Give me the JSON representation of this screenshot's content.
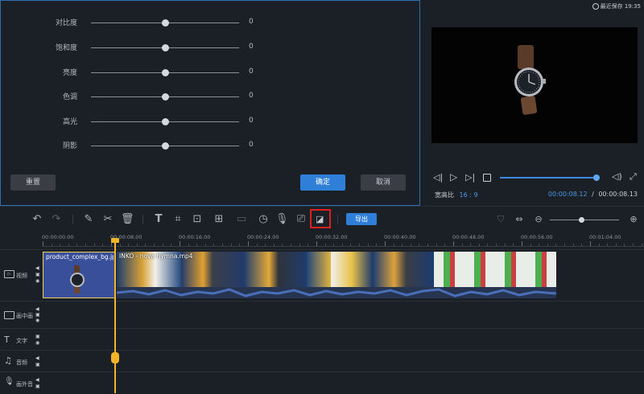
{
  "status": {
    "last_saved": "最近保存 19:35"
  },
  "adjust": {
    "rows": [
      {
        "label": "对比度",
        "value": "0",
        "level": 0.5
      },
      {
        "label": "饱和度",
        "value": "0",
        "level": 0.5
      },
      {
        "label": "亮度",
        "value": "0",
        "level": 0.5
      },
      {
        "label": "色调",
        "value": "0",
        "level": 0.5
      },
      {
        "label": "高光",
        "value": "0",
        "level": 0.5
      },
      {
        "label": "阴影",
        "value": "0",
        "level": 0.5
      }
    ],
    "reset_label": "重置",
    "confirm_label": "确定",
    "cancel_label": "取消"
  },
  "preview": {
    "aspect_label": "宽高比",
    "aspect_value": "16 : 9",
    "current_time": "00:00:08.12",
    "separator": "/",
    "total_time": "00:00:08.13",
    "progress": 0.999
  },
  "toolbar": {
    "icons": [
      "undo-icon",
      "redo-icon",
      "pen-icon",
      "scissors-icon",
      "trash-icon",
      "text-icon",
      "crop-icon",
      "transform-icon",
      "split-screen-icon",
      "placeholder-icon",
      "timer-icon",
      "mic-icon",
      "screen-record-icon",
      "color-adjust-icon"
    ],
    "export_label": "导出",
    "zoom_level": 0.45
  },
  "ruler": {
    "ticks": [
      "00:00:00.00",
      "00:00:08.00",
      "00:00:16.00",
      "00:00:24.00",
      "00:00:32.00",
      "00:00:40.00",
      "00:00:48.00",
      "00:00:56.00",
      "00:01:04.00"
    ]
  },
  "tracks": {
    "video": "视频",
    "pip": "画中画",
    "text": "文字",
    "audio": "音频",
    "voiceover": "画外音"
  },
  "clips": {
    "image_clip": "product_complex_bg.jpg",
    "video_clip": "INKO - nova hymna.mp4"
  },
  "colors": {
    "accent": "#2f7fd8",
    "playhead": "#f0b429",
    "panel_border": "#2d6fb3",
    "image_clip_bg": "#3a4f99"
  }
}
